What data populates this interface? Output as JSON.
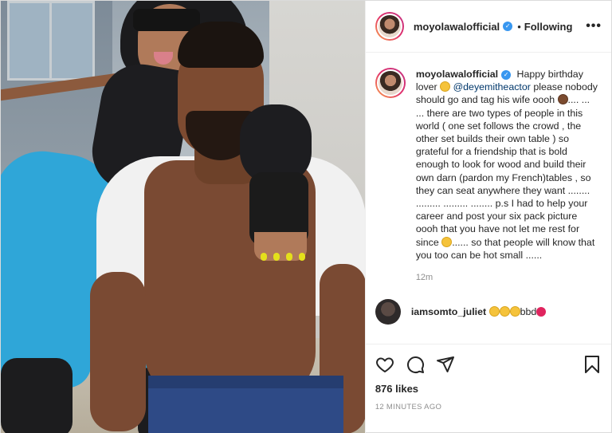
{
  "header": {
    "username": "moyolawalofficial",
    "verified_glyph": "✓",
    "separator": "•",
    "follow_status": "Following",
    "more_label": "•••"
  },
  "caption": {
    "username": "moyolawalofficial",
    "part1": " Happy birthday lover ",
    "mention": "@deyemitheactor",
    "part2": " please nobody should go and tag his wife oooh ",
    "part3": ".... ... ... there are two types of people in this world ( one set follows the crowd , the other set builds their own table ) so grateful for a friendship that is bold enough to look for wood and build their own darn (pardon my French)tables , so they can seat anywhere they want ........ ......... ......... ........ p.s I had to help your career and post your six pack picture oooh that you have not let me rest for since ",
    "part4": "...... so that people will know that you too can be hot small ......",
    "time": "12m"
  },
  "comment": {
    "username": "iamsomto_juliet",
    "text": "bbd"
  },
  "post": {
    "likes": "876 likes",
    "posted_ago": "12 MINUTES AGO"
  },
  "icons": [
    "heart-icon",
    "comment-icon",
    "share-icon",
    "bookmark-icon"
  ]
}
